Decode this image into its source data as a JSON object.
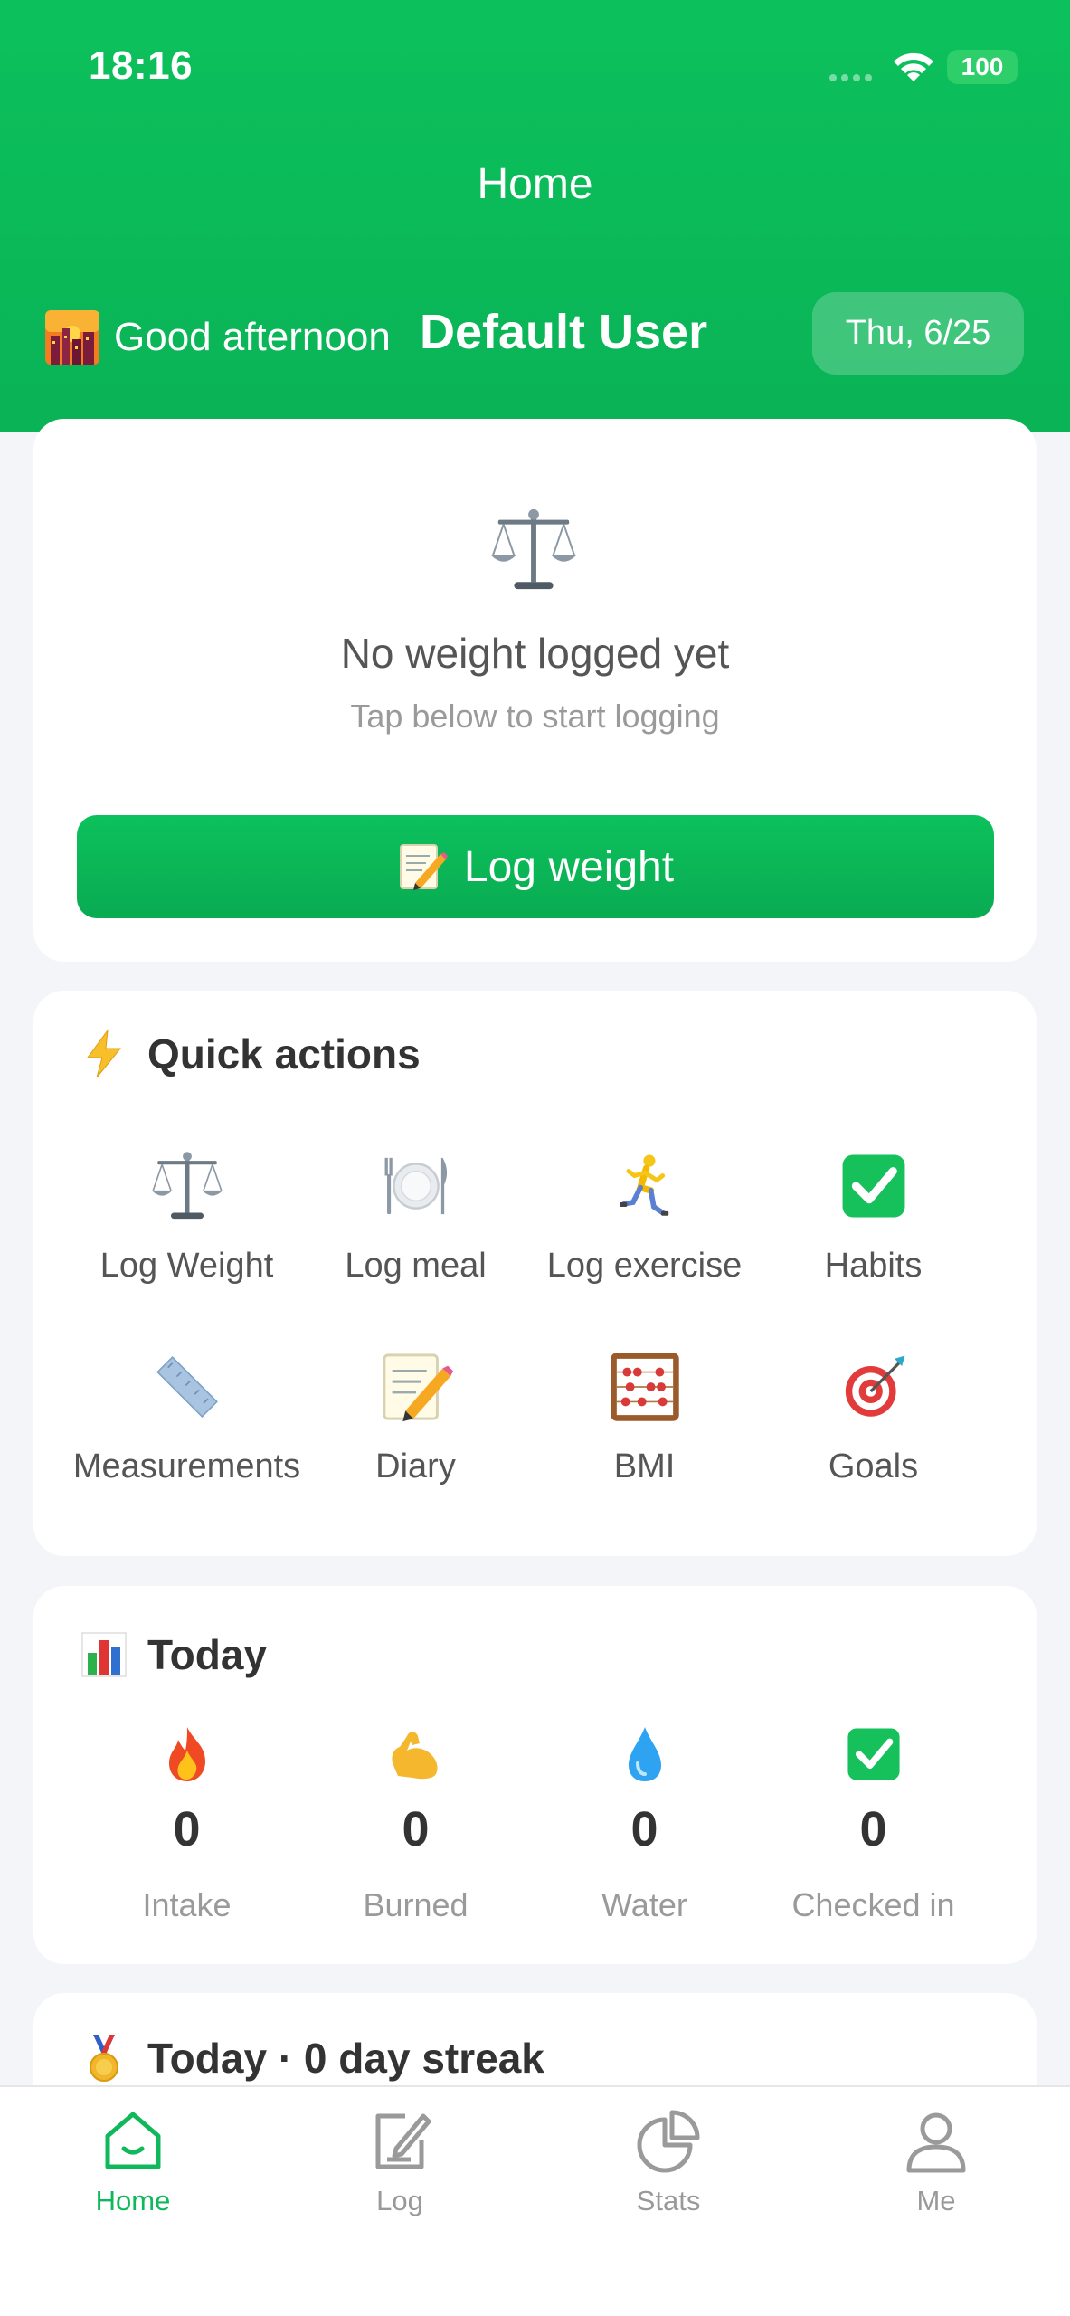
{
  "status_bar": {
    "time": "18:16",
    "battery": "100"
  },
  "nav": {
    "title": "Home"
  },
  "greeting": {
    "prefix": "Good afternoon",
    "user_name": "Default User",
    "date": "Thu, 6/25"
  },
  "weight_card": {
    "icon": "balance-scale-icon",
    "empty_title": "No weight logged yet",
    "empty_subtitle": "Tap below to start logging",
    "button_label": "Log weight",
    "button_icon": "memo-icon"
  },
  "quick_actions": {
    "title": "Quick actions",
    "icon": "lightning-icon",
    "items": [
      {
        "label": "Log Weight",
        "icon": "balance-scale-icon"
      },
      {
        "label": "Log meal",
        "icon": "plate-cutlery-icon"
      },
      {
        "label": "Log exercise",
        "icon": "runner-icon"
      },
      {
        "label": "Habits",
        "icon": "check-box-icon"
      },
      {
        "label": "Measurements",
        "icon": "ruler-icon"
      },
      {
        "label": "Diary",
        "icon": "memo-icon"
      },
      {
        "label": "BMI",
        "icon": "abacus-icon"
      },
      {
        "label": "Goals",
        "icon": "target-icon"
      }
    ]
  },
  "today": {
    "title": "Today",
    "icon": "bar-chart-icon",
    "stats": [
      {
        "label": "Intake",
        "value": "0",
        "icon": "fire-icon"
      },
      {
        "label": "Burned",
        "value": "0",
        "icon": "flexed-biceps-icon"
      },
      {
        "label": "Water",
        "value": "0",
        "icon": "water-drop-icon"
      },
      {
        "label": "Checked in",
        "value": "0",
        "icon": "check-box-icon"
      }
    ]
  },
  "streak": {
    "title": "Today · 0 day streak",
    "icon": "medal-icon"
  },
  "tabbar": {
    "active": "Home",
    "tabs": [
      {
        "label": "Home",
        "icon": "home-icon"
      },
      {
        "label": "Log",
        "icon": "edit-icon"
      },
      {
        "label": "Stats",
        "icon": "pie-chart-icon"
      },
      {
        "label": "Me",
        "icon": "user-icon"
      }
    ]
  },
  "colors": {
    "primary": "#0cc15c",
    "background": "#f4f5f9",
    "card": "#ffffff"
  }
}
